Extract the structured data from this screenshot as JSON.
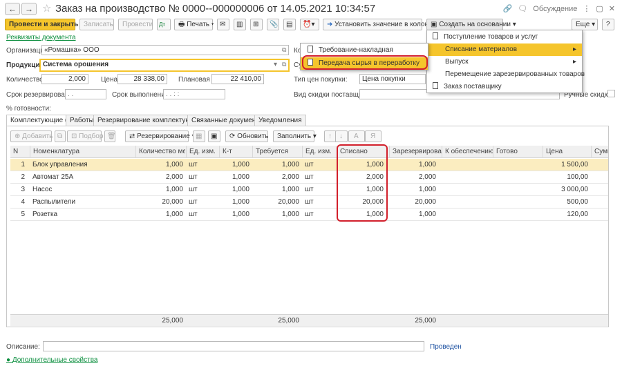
{
  "window": {
    "title": "Заказ на производство № 0000--000000006 от 14.05.2021 10:34:57",
    "discussion_label": "Обсуждение"
  },
  "toolbar": {
    "post_close": "Провести и закрыть",
    "save": "Записать",
    "post": "Провести",
    "print": "Печать",
    "set_value_column": "Установить значение в колонке",
    "create_based_on": "Создать на основании",
    "more": "Еще",
    "help": "?"
  },
  "doc_requisites_link": "Реквизиты документа",
  "form": {
    "org_label": "Организация:",
    "org_value": "«Ромашка» ООО",
    "product_label": "Продукция:",
    "product_value": "Система орошения",
    "qty_label": "Количество:",
    "qty_value": "2,000",
    "price_label": "Цена:",
    "price_value": "28 338,00",
    "plan_price_label": "Плановая цена:",
    "plan_price_value": "22 410,00",
    "reserve_term_label": "Срок резервирования:",
    "reserve_term_value": ". .",
    "exec_term_label": "Срок выполнения:",
    "exec_term_value": ". . : :",
    "readiness_label": "% готовности:",
    "price_type_label": "Тип цен покупки:",
    "price_type_value": "Цена покупки",
    "discount_type_label": "Вид скидки поставщика:",
    "manual_discount_label": "Ручные скидки:",
    "ko_label": "Ко",
    "su_label": "Су"
  },
  "tabs": [
    "Комплектующие (5)",
    "Работы",
    "Резервирование комплектующих",
    "Связанные документы",
    "Уведомления"
  ],
  "table_toolbar": {
    "add": "Добавить",
    "pick": "Подбор",
    "reservation": "Резервирование",
    "refresh": "Обновить",
    "fill": "Заполнить"
  },
  "table": {
    "columns": [
      "N",
      "Номенклатура",
      "Количество мест",
      "Ед. изм.",
      "К-т",
      "Требуется",
      "Ед. изм.",
      "Списано",
      "Зарезервировано",
      "К обеспечению",
      "Готово",
      "Цена",
      "Сумм"
    ],
    "rows": [
      {
        "n": "1",
        "name": "Блок управления",
        "places": "1,000",
        "unit": "шт",
        "k": "1,000",
        "need": "1,000",
        "unit2": "шт",
        "written": "1,000",
        "reserved": "1,000",
        "to_provide": "",
        "ready": "",
        "price": "1 500,00"
      },
      {
        "n": "2",
        "name": "Автомат 25А",
        "places": "2,000",
        "unit": "шт",
        "k": "1,000",
        "need": "2,000",
        "unit2": "шт",
        "written": "2,000",
        "reserved": "2,000",
        "to_provide": "",
        "ready": "",
        "price": "100,00"
      },
      {
        "n": "3",
        "name": "Насос",
        "places": "1,000",
        "unit": "шт",
        "k": "1,000",
        "need": "1,000",
        "unit2": "шт",
        "written": "1,000",
        "reserved": "1,000",
        "to_provide": "",
        "ready": "",
        "price": "3 000,00"
      },
      {
        "n": "4",
        "name": "Распылители",
        "places": "20,000",
        "unit": "шт",
        "k": "1,000",
        "need": "20,000",
        "unit2": "шт",
        "written": "20,000",
        "reserved": "20,000",
        "to_provide": "",
        "ready": "",
        "price": "500,00"
      },
      {
        "n": "5",
        "name": "Розетка",
        "places": "1,000",
        "unit": "шт",
        "k": "1,000",
        "need": "1,000",
        "unit2": "шт",
        "written": "1,000",
        "reserved": "1,000",
        "to_provide": "",
        "ready": "",
        "price": "120,00"
      }
    ],
    "totals": {
      "places": "25,000",
      "need": "25,000",
      "reserved": "25,000"
    }
  },
  "bottom": {
    "description_label": "Описание:",
    "status": "Проведен",
    "extra_props_link": "Дополнительные свойства"
  },
  "menu_create": {
    "items": [
      "Поступление товаров и услуг",
      "Списание материалов",
      "Выпуск",
      "Перемещение зарезервированных товаров",
      "Заказ поставщику"
    ]
  },
  "submenu": {
    "items": [
      "Требование-накладная",
      "Передача сырья в переработку"
    ]
  },
  "colors": {
    "accent": "#f5c52c",
    "highlight_row": "#fbedc0",
    "annotation": "#d21f2b",
    "link": "#0c8f3f"
  }
}
